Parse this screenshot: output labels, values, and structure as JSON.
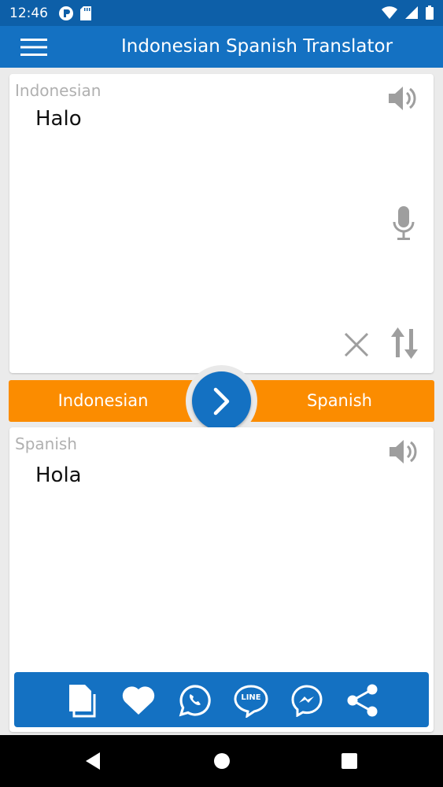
{
  "status_bar": {
    "time": "12:46",
    "icons": [
      "notification-icon",
      "sd-card-icon",
      "wifi-icon",
      "signal-icon",
      "battery-icon"
    ]
  },
  "app_bar": {
    "title": "Indonesian Spanish Translator",
    "menu_icon": "hamburger-menu-icon"
  },
  "source_panel": {
    "language_hint": "Indonesian",
    "text": "Halo",
    "icons": [
      "speaker-icon",
      "microphone-icon",
      "clear-icon",
      "swap-icon"
    ]
  },
  "language_bar": {
    "from": "Indonesian",
    "to": "Spanish",
    "translate_icon": "chevron-right-icon"
  },
  "target_panel": {
    "language_hint": "Spanish",
    "text": "Hola",
    "icons": [
      "speaker-icon"
    ]
  },
  "share_bar": {
    "actions": [
      "copy-icon",
      "favorite-icon",
      "whatsapp-icon",
      "line-icon",
      "messenger-icon",
      "share-icon"
    ],
    "line_text": "LINE"
  },
  "nav_bar": {
    "buttons": [
      "back-icon",
      "home-icon",
      "recents-icon"
    ]
  },
  "colors": {
    "primary": "#1471c2",
    "primary_dark": "#0d5fa8",
    "accent": "#fb8c00",
    "icon_gray": "#9e9e9e"
  }
}
